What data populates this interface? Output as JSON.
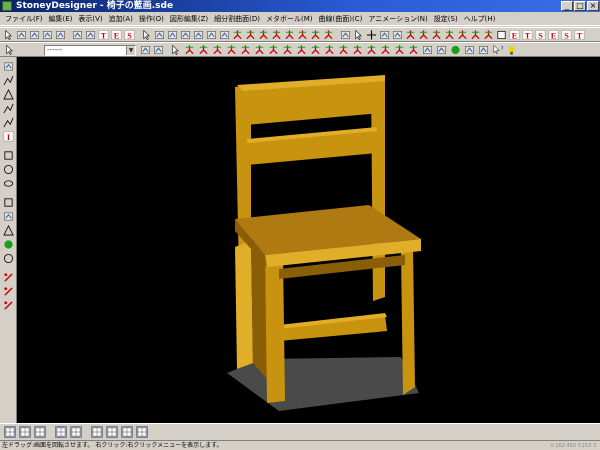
{
  "window": {
    "title": "StoneyDesigner - 椅子の藍画.sde",
    "minimize_label": "_",
    "maximize_label": "□",
    "close_label": "×"
  },
  "menu": [
    "ファイル(F)",
    "編集(E)",
    "表示(V)",
    "追加(A)",
    "操作(O)",
    "図形編集(Z)",
    "細分割曲面(D)",
    "メタボール(M)",
    "曲線(曲面)(C)",
    "アニメーション(N)",
    "設定(S)",
    "ヘルプ(H)"
  ],
  "toolbar2": {
    "layer_select_value": "------",
    "dropdown_arrow": "▼"
  },
  "left_toolbar_glyphs": {
    "text_tool": "A"
  },
  "status": {
    "hint": "左ドラッグ:画面を回転させます。 右クリック:右クリックメニューを表示します。",
    "coords": "X:162 450 Y:253 3"
  },
  "colors": {
    "viewport_bg": "#000000",
    "chair_top": "#b07a12",
    "chair_front": "#c8940f",
    "chair_side": "#8a5e06",
    "chair_light": "#e0ae28",
    "shadow": "#4a4a4a",
    "titlebar": "#0a246a"
  },
  "icons": {
    "toolbar1": [
      "cursor-icon",
      "new-file-icon",
      "open-icon",
      "save-icon",
      "print-icon",
      "pen-icon",
      "edit-icon",
      "text-t-icon",
      "text-e-icon",
      "text-s-icon",
      "cursor-icon",
      "move-icon",
      "rotate-icon",
      "scale-icon",
      "mirror-icon",
      "copy-icon",
      "delete-icon",
      "axis-icon",
      "axis-icon",
      "axis-icon",
      "axis-icon",
      "axis-icon",
      "axis-icon",
      "axis-icon",
      "axis-icon",
      "paint-icon",
      "cursor-icon",
      "cross-icon",
      "rotate-icon",
      "scale-icon",
      "axis-icon",
      "axis-icon",
      "axis-icon",
      "axis-icon",
      "axis-icon",
      "axis-icon",
      "axis-icon",
      "square-icon",
      "text-e-icon",
      "text-t-icon",
      "text-s-icon",
      "text-e-icon",
      "text-s-icon",
      "text-t-icon"
    ],
    "toolbar2": [
      "cursor-icon",
      "layer-select-icon",
      "undo-icon",
      "redo-icon",
      "cursor-icon",
      "axis-icon",
      "axis-icon",
      "axis-icon",
      "axis-icon",
      "axis-icon",
      "axis-icon",
      "axis-icon",
      "axis-icon",
      "axis-icon",
      "axis-icon",
      "axis-icon",
      "axis-icon",
      "axis-icon",
      "axis-icon",
      "axis-icon",
      "axis-icon",
      "axis-icon",
      "render-icon",
      "render-icon",
      "sphere-icon",
      "image-icon",
      "image-icon",
      "help-icon",
      "bulb-icon"
    ],
    "left": [
      "select-icon",
      "line-icon",
      "triangle-icon",
      "polyline-icon",
      "curve-icon",
      "text-icon",
      "rectangle-icon",
      "circle-icon",
      "ellipse-icon",
      "cube-icon",
      "cylinder-icon",
      "cone-icon",
      "sphere-icon",
      "torus-icon",
      "dot-icon",
      "cut-icon",
      "knife-icon"
    ],
    "bottom": [
      "view-front-icon",
      "view-grid-icon",
      "view-3d-icon",
      "view-top-icon",
      "view-split-icon",
      "view-angle-icon",
      "view-mirror-icon",
      "view-point-icon",
      "view-axis-icon"
    ]
  }
}
